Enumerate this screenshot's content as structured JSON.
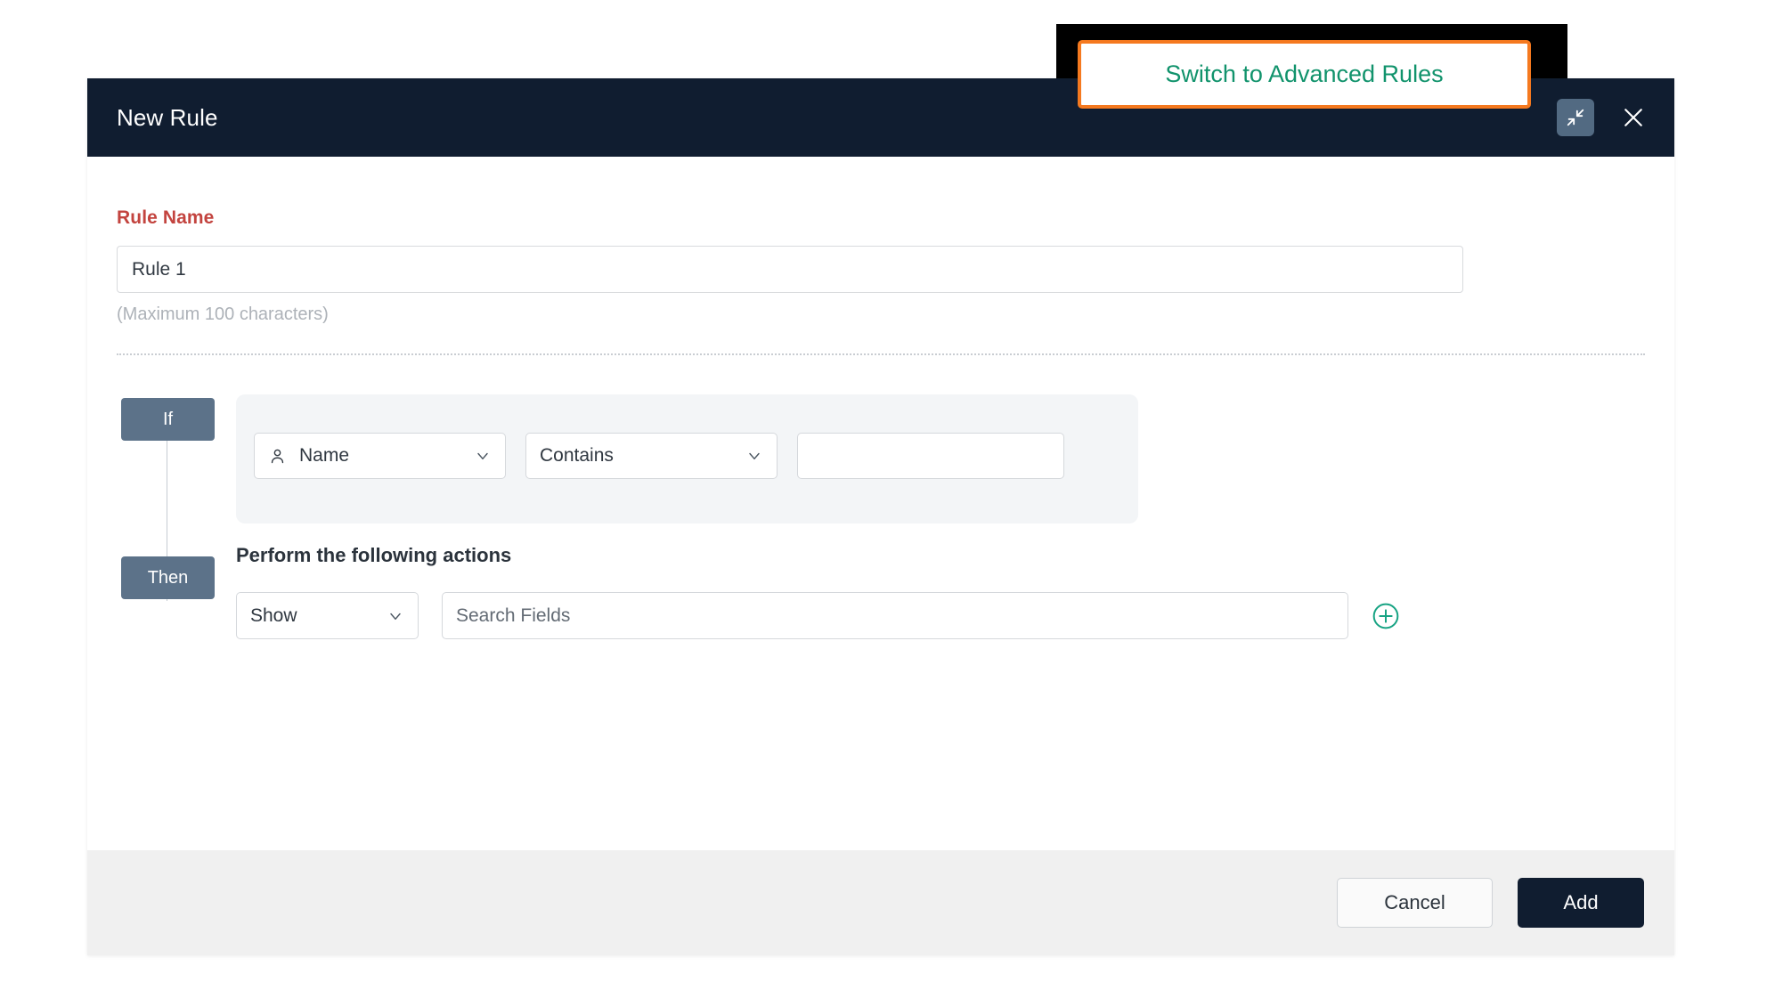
{
  "header": {
    "title": "New Rule",
    "collapse_icon": "collapse-arrows-icon",
    "close_icon": "close-icon"
  },
  "switch_button": {
    "label": "Switch to Advanced Rules",
    "text_color": "#11936c",
    "highlight_color": "#f5791f"
  },
  "rule_name": {
    "label": "Rule Name",
    "label_color": "#c3443f",
    "value": "Rule 1",
    "placeholder": "Rule Name",
    "hint": "(Maximum 100 characters)"
  },
  "builder": {
    "if_badge": "If",
    "then_badge": "Then",
    "badge_color": "#5c7289",
    "condition": {
      "field": {
        "value": "Name",
        "icon": "user-icon",
        "chevron": "chevron-down-icon"
      },
      "operator": {
        "value": "Contains",
        "chevron": "chevron-down-icon"
      },
      "value": {
        "value": "",
        "placeholder": ""
      }
    },
    "actions": {
      "heading": "Perform the following actions",
      "action_type": {
        "value": "Show",
        "chevron": "chevron-down-icon"
      },
      "fields_search": {
        "value": "",
        "placeholder": "Search Fields"
      },
      "add_icon": "plus-circle-icon",
      "add_icon_color": "#17a383"
    }
  },
  "footer": {
    "cancel_label": "Cancel",
    "add_label": "Add",
    "add_bg": "#101d30"
  }
}
